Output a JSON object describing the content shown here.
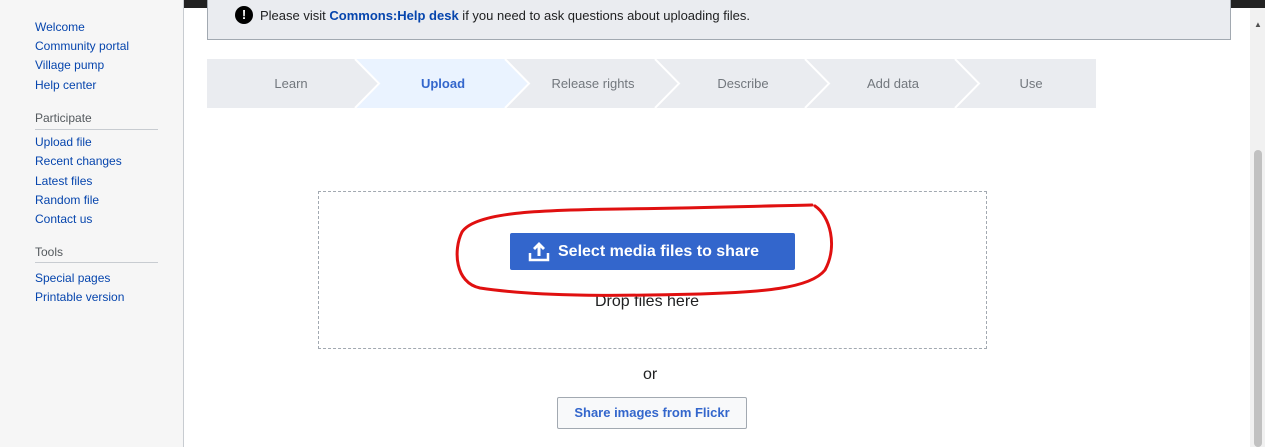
{
  "sidebar": {
    "navigation": [
      "Welcome",
      "Community portal",
      "Village pump",
      "Help center"
    ],
    "participate_heading": "Participate",
    "participate": [
      "Upload file",
      "Recent changes",
      "Latest files",
      "Random file",
      "Contact us"
    ],
    "tools_heading": "Tools",
    "tools": [
      "Special pages",
      "Printable version"
    ]
  },
  "notice": {
    "prefix": "Please visit ",
    "link": "Commons:Help desk",
    "suffix": " if you need to ask questions about uploading files."
  },
  "steps": [
    {
      "label": "Learn",
      "active": false
    },
    {
      "label": "Upload",
      "active": true
    },
    {
      "label": "Release rights",
      "active": false
    },
    {
      "label": "Describe",
      "active": false
    },
    {
      "label": "Add data",
      "active": false
    },
    {
      "label": "Use",
      "active": false
    }
  ],
  "upload": {
    "select_button": "Select media files to share",
    "drop_text": "Drop files here",
    "or_text": "or",
    "flickr_button": "Share images from Flickr"
  },
  "colors": {
    "accent": "#3366cc",
    "link": "#0645ad",
    "annotation": "#e01010"
  },
  "icons": [
    "upload-icon",
    "exclamation-icon"
  ]
}
